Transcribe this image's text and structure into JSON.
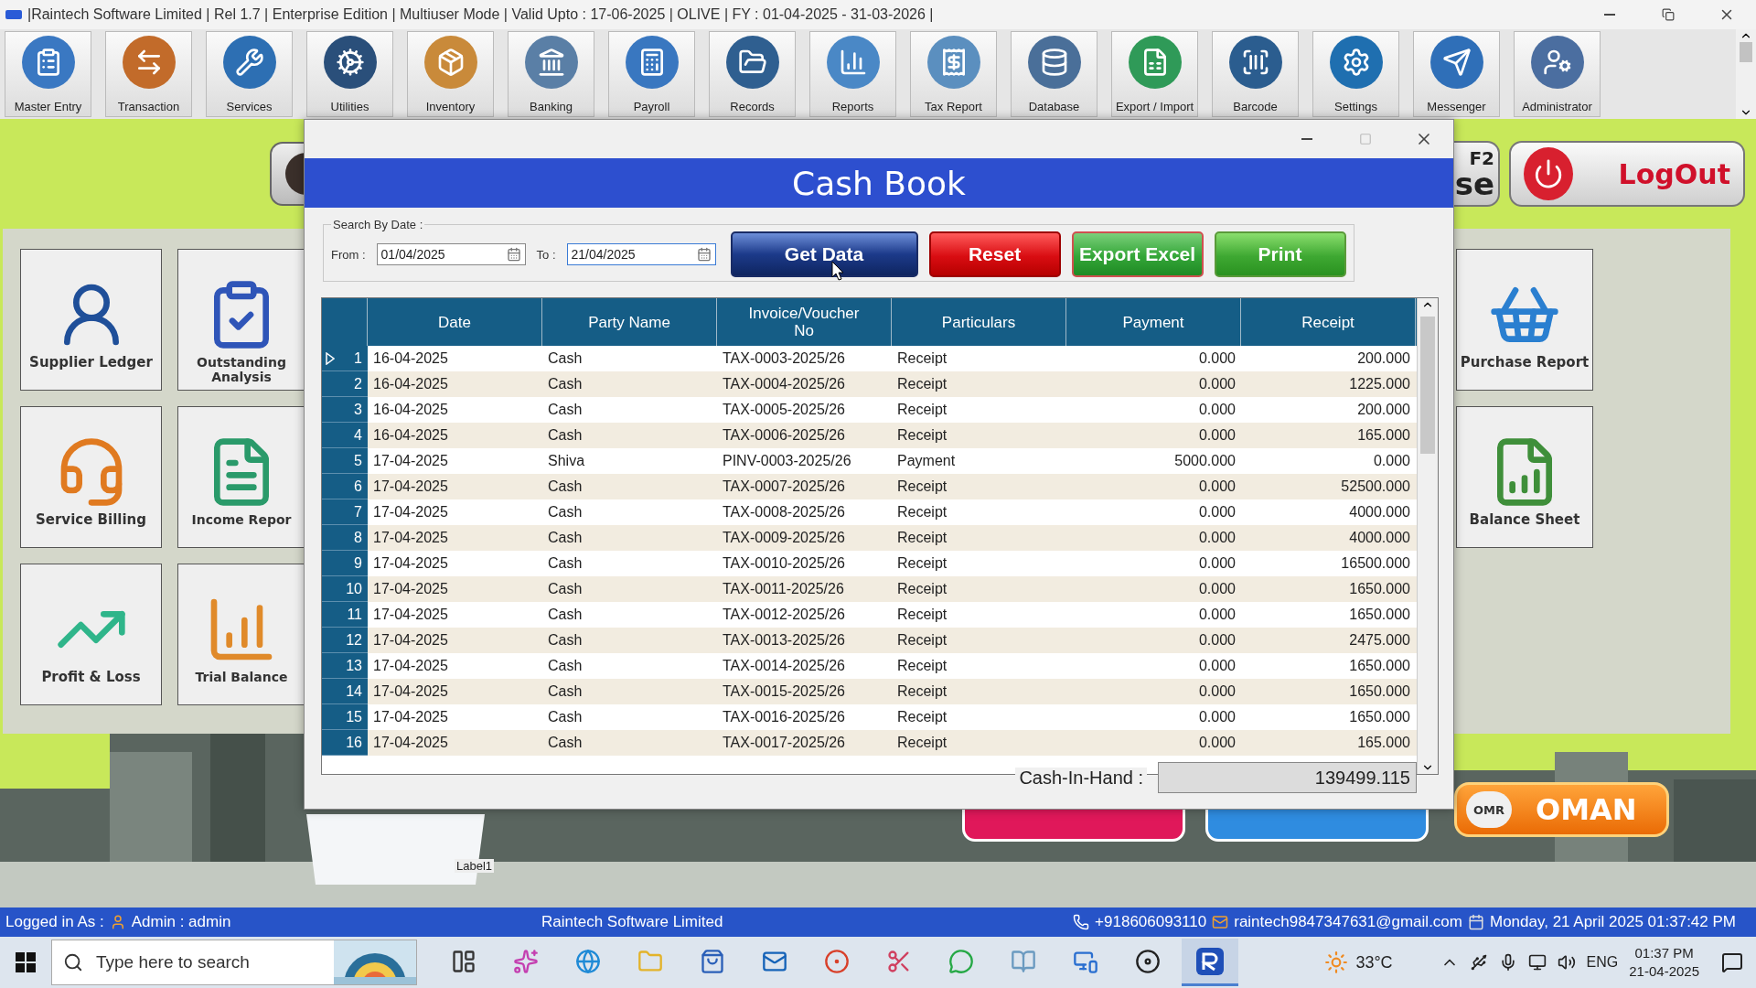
{
  "window": {
    "title": "|Raintech Software Limited | Rel 1.7 | Enterprise Edition | Multiuser Mode | Valid Upto : 17-06-2025 | OLIVE | FY : 01-04-2025 - 31-03-2026 |"
  },
  "toolbar": [
    "Master Entry",
    "Transaction",
    "Services",
    "Utilities",
    "Inventory",
    "Banking",
    "Payroll",
    "Records",
    "Reports",
    "Tax Report",
    "Database",
    "Export / Import",
    "Barcode",
    "Settings",
    "Messenger",
    "Administrator"
  ],
  "dashboard": {
    "left_tiles": [
      {
        "label": "Supplier Ledger"
      },
      {
        "label": "Outstanding Analysis"
      },
      {
        "label": "Service Billing"
      },
      {
        "label": "Income Repor"
      },
      {
        "label": "Profit & Loss"
      },
      {
        "label": "Trial Balance"
      }
    ],
    "right_tiles": [
      {
        "label": "Purchase Report"
      },
      {
        "label": "Balance Sheet"
      }
    ],
    "shortcut_button": {
      "text": "se",
      "key": "F2"
    },
    "logout_button": "LogOut",
    "currency_button": {
      "code": "OMR",
      "label": "OMAN"
    },
    "image_label": "Label1"
  },
  "dialog": {
    "title": "Cash Book",
    "search_group": "Search By Date :",
    "from_label": "From :",
    "from_value": "01/04/2025",
    "to_label": "To :",
    "to_value": "21/04/2025",
    "buttons": [
      {
        "label": "Get Data",
        "kind": "primary"
      },
      {
        "label": "Reset",
        "kind": "danger"
      },
      {
        "label": "Export Excel",
        "kind": "excel"
      },
      {
        "label": "Print",
        "kind": "success"
      }
    ],
    "table": {
      "columns": [
        "Date",
        "Party Name",
        "Invoice/Voucher No",
        "Particulars",
        "Payment",
        "Receipt"
      ],
      "rows": [
        {
          "number": "1",
          "selected": true,
          "cells": [
            "16-04-2025",
            "Cash",
            "TAX-0003-2025/26",
            "Receipt",
            "0.000",
            "200.000"
          ]
        },
        {
          "number": "2",
          "selected": false,
          "cells": [
            "16-04-2025",
            "Cash",
            "TAX-0004-2025/26",
            "Receipt",
            "0.000",
            "1225.000"
          ]
        },
        {
          "number": "3",
          "selected": false,
          "cells": [
            "16-04-2025",
            "Cash",
            "TAX-0005-2025/26",
            "Receipt",
            "0.000",
            "200.000"
          ]
        },
        {
          "number": "4",
          "selected": false,
          "cells": [
            "16-04-2025",
            "Cash",
            "TAX-0006-2025/26",
            "Receipt",
            "0.000",
            "165.000"
          ]
        },
        {
          "number": "5",
          "selected": false,
          "cells": [
            "17-04-2025",
            "Shiva",
            "PINV-0003-2025/26",
            "Payment",
            "5000.000",
            "0.000"
          ]
        },
        {
          "number": "6",
          "selected": false,
          "cells": [
            "17-04-2025",
            "Cash",
            "TAX-0007-2025/26",
            "Receipt",
            "0.000",
            "52500.000"
          ]
        },
        {
          "number": "7",
          "selected": false,
          "cells": [
            "17-04-2025",
            "Cash",
            "TAX-0008-2025/26",
            "Receipt",
            "0.000",
            "4000.000"
          ]
        },
        {
          "number": "8",
          "selected": false,
          "cells": [
            "17-04-2025",
            "Cash",
            "TAX-0009-2025/26",
            "Receipt",
            "0.000",
            "4000.000"
          ]
        },
        {
          "number": "9",
          "selected": false,
          "cells": [
            "17-04-2025",
            "Cash",
            "TAX-0010-2025/26",
            "Receipt",
            "0.000",
            "16500.000"
          ]
        },
        {
          "number": "10",
          "selected": false,
          "cells": [
            "17-04-2025",
            "Cash",
            "TAX-0011-2025/26",
            "Receipt",
            "0.000",
            "1650.000"
          ]
        },
        {
          "number": "11",
          "selected": false,
          "cells": [
            "17-04-2025",
            "Cash",
            "TAX-0012-2025/26",
            "Receipt",
            "0.000",
            "1650.000"
          ]
        },
        {
          "number": "12",
          "selected": false,
          "cells": [
            "17-04-2025",
            "Cash",
            "TAX-0013-2025/26",
            "Receipt",
            "0.000",
            "2475.000"
          ]
        },
        {
          "number": "13",
          "selected": false,
          "cells": [
            "17-04-2025",
            "Cash",
            "TAX-0014-2025/26",
            "Receipt",
            "0.000",
            "1650.000"
          ]
        },
        {
          "number": "14",
          "selected": false,
          "cells": [
            "17-04-2025",
            "Cash",
            "TAX-0015-2025/26",
            "Receipt",
            "0.000",
            "1650.000"
          ]
        },
        {
          "number": "15",
          "selected": false,
          "cells": [
            "17-04-2025",
            "Cash",
            "TAX-0016-2025/26",
            "Receipt",
            "0.000",
            "1650.000"
          ]
        },
        {
          "number": "16",
          "selected": false,
          "cells": [
            "17-04-2025",
            "Cash",
            "TAX-0017-2025/26",
            "Receipt",
            "0.000",
            "165.000"
          ]
        }
      ]
    },
    "cash_in_hand_label": "Cash-In-Hand :",
    "cash_in_hand_value": "139499.115"
  },
  "status_bar": {
    "logged_in_label": "Logged in As :",
    "user": "Admin  :  admin",
    "company": "Raintech Software Limited",
    "phone": "+918606093110",
    "email": "raintech9847347631@gmail.com",
    "datetime": "Monday, 21 April 2025 01:37:42 PM"
  },
  "taskbar": {
    "search_placeholder": "Type here to search",
    "temperature": "33°C",
    "language": "ENG",
    "time": "01:37 PM",
    "date": "21-04-2025"
  }
}
